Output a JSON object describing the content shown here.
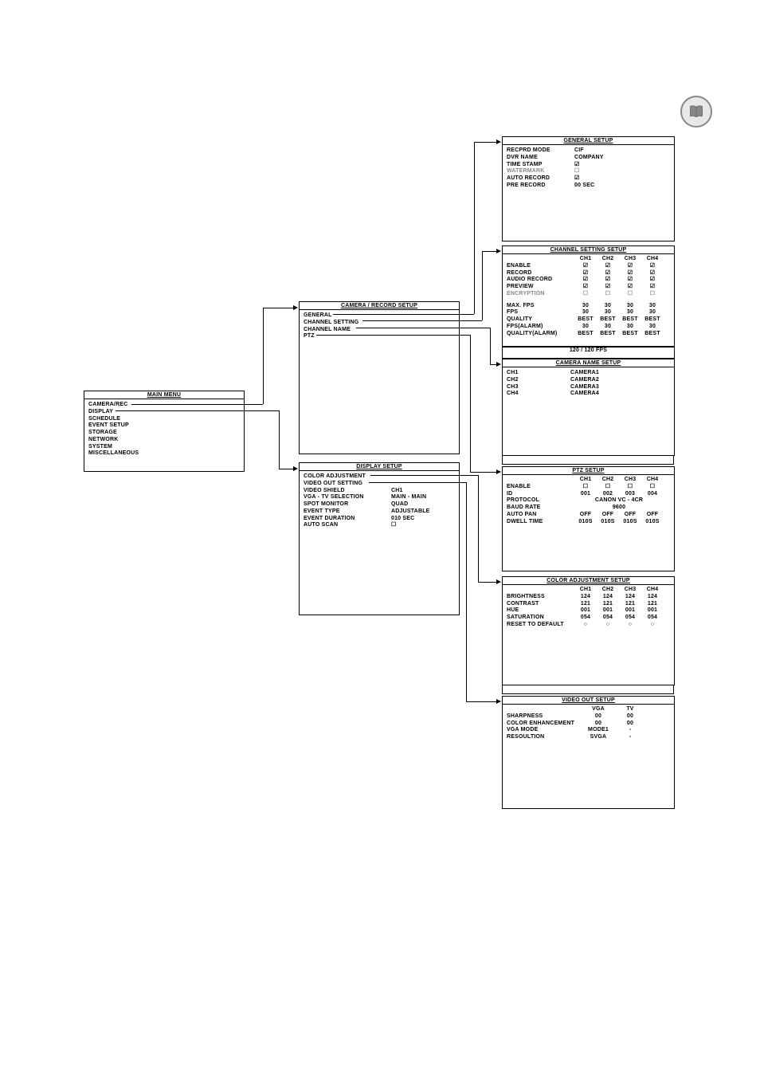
{
  "icon": "book-icon",
  "main_menu": {
    "title": "MAIN  MENU",
    "items": [
      "CAMERA/REC",
      "DISPLAY",
      "SCHEDULE",
      "EVENT SETUP",
      "STORAGE",
      "NETWORK",
      "SYSTEM",
      "MISCELLANEOUS"
    ]
  },
  "camera_record": {
    "title": "CAMERA / RECORD  SETUP",
    "items": [
      "GENERAL",
      "CHANNEL SETTING",
      "CHANNEL NAME",
      "PTZ"
    ]
  },
  "display_setup": {
    "title": "DISPLAY  SETUP",
    "rows": [
      {
        "label": "COLOR ADJUSTMENT",
        "val": ""
      },
      {
        "label": "VIDEO OUT SETTING",
        "val": ""
      },
      {
        "label": "VIDEO SHIELD",
        "val": "CH1"
      },
      {
        "label": "VGA - TV  SELECTION",
        "val": "MAIN - MAIN"
      },
      {
        "label": "SPOT MONITOR",
        "val": "QUAD"
      },
      {
        "label": "EVENT TYPE",
        "val": "ADJUSTABLE"
      },
      {
        "label": "EVENT DURATION",
        "val": "010 SEC"
      },
      {
        "label": "AUTO SCAN",
        "val": "☐"
      }
    ]
  },
  "general_setup": {
    "title": "GENERAL  SETUP",
    "rows": [
      {
        "label": "RECPRD MODE",
        "val": "CIF"
      },
      {
        "label": "DVR NAME",
        "val": "COMPANY"
      },
      {
        "label": "TIME STAMP",
        "val": "☑"
      },
      {
        "label": "WATERMARK",
        "val": "☐",
        "gray": true
      },
      {
        "label": "AUTO RECORD",
        "val": "☑"
      },
      {
        "label": "PRE RECORD",
        "val": "00 SEC"
      }
    ]
  },
  "channel_setting": {
    "title": "CHANNEL  SETTING  SETUP",
    "head": [
      "CH1",
      "CH2",
      "CH3",
      "CH4"
    ],
    "rows1": [
      {
        "label": "ENABLE",
        "v": [
          "☑",
          "☑",
          "☑",
          "☑"
        ]
      },
      {
        "label": "RECORD",
        "v": [
          "☑",
          "☑",
          "☑",
          "☑"
        ]
      },
      {
        "label": "AUDIO RECORD",
        "v": [
          "☑",
          "☑",
          "☑",
          "☑"
        ]
      },
      {
        "label": "PREVIEW",
        "v": [
          "☑",
          "☑",
          "☑",
          "☑"
        ]
      },
      {
        "label": "ENCRYPTION",
        "v": [
          "☐",
          "☐",
          "☐",
          "☐"
        ],
        "gray": true
      }
    ],
    "rows2": [
      {
        "label": "MAX. FPS",
        "v": [
          "30",
          "30",
          "30",
          "30"
        ]
      },
      {
        "label": "FPS",
        "v": [
          "30",
          "30",
          "30",
          "30"
        ]
      },
      {
        "label": "QUALITY",
        "v": [
          "BEST",
          "BEST",
          "BEST",
          "BEST"
        ]
      },
      {
        "label": "FPS(ALARM)",
        "v": [
          "30",
          "30",
          "30",
          "30"
        ]
      },
      {
        "label": "QUALITY(ALARM)",
        "v": [
          "BEST",
          "BEST",
          "BEST",
          "BEST"
        ]
      }
    ],
    "footer": "120 / 120 FPS"
  },
  "camera_name": {
    "title": "CAMERA  NAME  SETUP",
    "rows": [
      {
        "label": "CH1",
        "val": "CAMERA1"
      },
      {
        "label": "CH2",
        "val": "CAMERA2"
      },
      {
        "label": "CH3",
        "val": "CAMERA3"
      },
      {
        "label": "CH4",
        "val": "CAMERA4"
      }
    ]
  },
  "ptz": {
    "title": "PTZ  SETUP",
    "head": [
      "CH1",
      "CH2",
      "CH3",
      "CH4"
    ],
    "rows": [
      {
        "label": "ENABLE",
        "v": [
          "☐",
          "☐",
          "☐",
          "☐"
        ]
      },
      {
        "label": "ID",
        "v": [
          "001",
          "002",
          "003",
          "004"
        ]
      }
    ],
    "protocol_label": "PROTOCOL",
    "protocol_val": "CANON VC - 4CR",
    "baud_label": "BAUD RATE",
    "baud_val": "9600",
    "rows2": [
      {
        "label": "AUTO PAN",
        "v": [
          "OFF",
          "OFF",
          "OFF",
          "OFF"
        ]
      },
      {
        "label": "DWELL TIME",
        "v": [
          "010S",
          "010S",
          "010S",
          "010S"
        ]
      }
    ]
  },
  "color_adj": {
    "title": "COLOR  ADJUSTMENT  SETUP",
    "head": [
      "CH1",
      "CH2",
      "CH3",
      "CH4"
    ],
    "rows": [
      {
        "label": "BRIGHTNESS",
        "v": [
          "124",
          "124",
          "124",
          "124"
        ]
      },
      {
        "label": "CONTRAST",
        "v": [
          "121",
          "121",
          "121",
          "121"
        ]
      },
      {
        "label": "HUE",
        "v": [
          "001",
          "001",
          "001",
          "001"
        ]
      },
      {
        "label": "SATURATION",
        "v": [
          "054",
          "054",
          "054",
          "054"
        ]
      },
      {
        "label": "RESET TO DEFAULT",
        "v": [
          "○",
          "○",
          "○",
          "○"
        ]
      }
    ]
  },
  "video_out": {
    "title": "VIDEO  OUT  SETUP",
    "head": [
      "VGA",
      "TV"
    ],
    "rows": [
      {
        "label": "SHARPNESS",
        "v": [
          "00",
          "00"
        ]
      },
      {
        "label": "COLOR ENHANCEMENT",
        "v": [
          "00",
          "00"
        ]
      },
      {
        "label": "VGA MODE",
        "v": [
          "MODE1",
          "-"
        ]
      },
      {
        "label": "RESOULTION",
        "v": [
          "SVGA",
          "-"
        ]
      }
    ]
  }
}
